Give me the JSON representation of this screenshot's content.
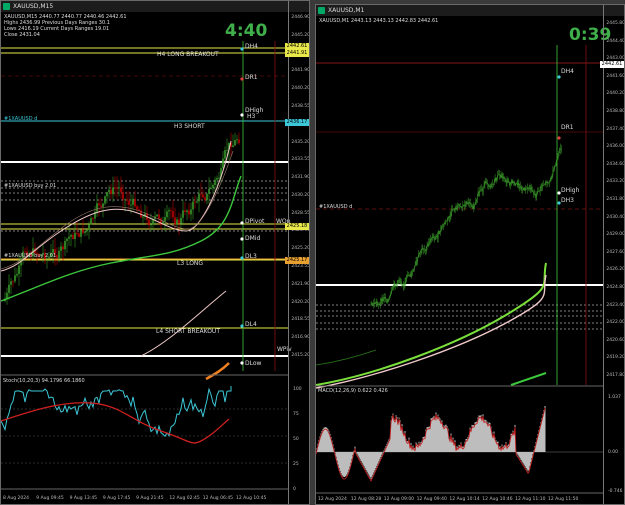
{
  "left": {
    "title": "XAUUSD,M15",
    "info": [
      "XAUUSD,M15 2440.77 2440.77 2440.46 2442.61",
      "Highs 2436.99   Previous Days Ranges 30.1",
      "Lows 2416.19    Current Days Ranges 19.01",
      "Close 2431.04"
    ],
    "timer": "4:40",
    "labels": {
      "dh4": "DH4",
      "dr1": "DR1",
      "dhigh": "DHigh",
      "h3": "H3",
      "h4_long": "H4 LONG BREAKOUT",
      "h3_short": "H3 SHORT",
      "dpivot": "DPivot",
      "wop": "WOp",
      "dmid": "DMid",
      "dl3": "DL3",
      "l3_long": "L3 LONG",
      "dl4": "DL4",
      "l4_short": "L4 SHORT BREAKOUT",
      "wpiv": "WPiv",
      "dlow": "DLow",
      "ob1": "#1XAUUSD d",
      "ob2": "#1XAUUSD buy 2.01",
      "ob3": "#1XAUUSD buy 2.01"
    },
    "price_box": [
      "2442.61",
      "2441.91",
      "2436.17",
      "2425.18",
      "2425.17"
    ],
    "axis": [
      "2446.90",
      "2445.20",
      "2443.55",
      "2441.90",
      "2440.20",
      "2438.55",
      "2436.90",
      "2435.20",
      "2433.55",
      "2431.90",
      "2430.20",
      "2428.55",
      "2426.90",
      "2425.20",
      "2423.55",
      "2421.90",
      "2420.20",
      "2418.55",
      "2416.90",
      "2415.20"
    ],
    "stoch_label": "Stoch(10,20,3) 94.1796 66.1860",
    "stoch_axis": [
      "100",
      "75",
      "50",
      "25",
      "0"
    ],
    "time_labels": [
      "8 Aug 2024",
      "9 Aug 09:45",
      "9 Aug 13:45",
      "9 Aug 17:45",
      "9 Aug 21:45",
      "12 Aug 02:45",
      "12 Aug 06:45",
      "12 Aug 10:45"
    ]
  },
  "right": {
    "title": "XAUUSD,M1",
    "info": [
      "XAUUSD,M1 2443.13 2443.13 2442.83 2442.61"
    ],
    "timer": "0:39",
    "labels": {
      "dh4": "DH4",
      "dr1": "DR1",
      "dhigh": "DHigh",
      "dh3": "DH3",
      "ob": "#1XAUUSD d"
    },
    "price_box": "2442.61",
    "axis": [
      "2445.80",
      "2444.40",
      "2443.00",
      "2441.60",
      "2440.20",
      "2438.80",
      "2437.40",
      "2436.00",
      "2434.60",
      "2433.20",
      "2431.80",
      "2430.40",
      "2429.00",
      "2427.60",
      "2426.20",
      "2424.80",
      "2423.40",
      "2422.00",
      "2420.60",
      "2419.20",
      "2417.80"
    ],
    "macd_label": "MACD(12,26,9) 0.622 0.426",
    "macd_axis": [
      "1.037",
      "0.00",
      "-0.746"
    ],
    "time_labels": [
      "12 Aug 2024",
      "12 Aug 08:28",
      "12 Aug 09:00",
      "12 Aug 09:40",
      "12 Aug 10:14",
      "12 Aug 10:46",
      "12 Aug 11:10",
      "12 Aug 11:50"
    ]
  },
  "colors": {
    "bull": "#3a9a2a",
    "bear": "#c00000",
    "yellow": "#e8e84a",
    "cyan": "#3cc8d8",
    "green": "#3cc83c",
    "pink": "#f0c8c8"
  }
}
